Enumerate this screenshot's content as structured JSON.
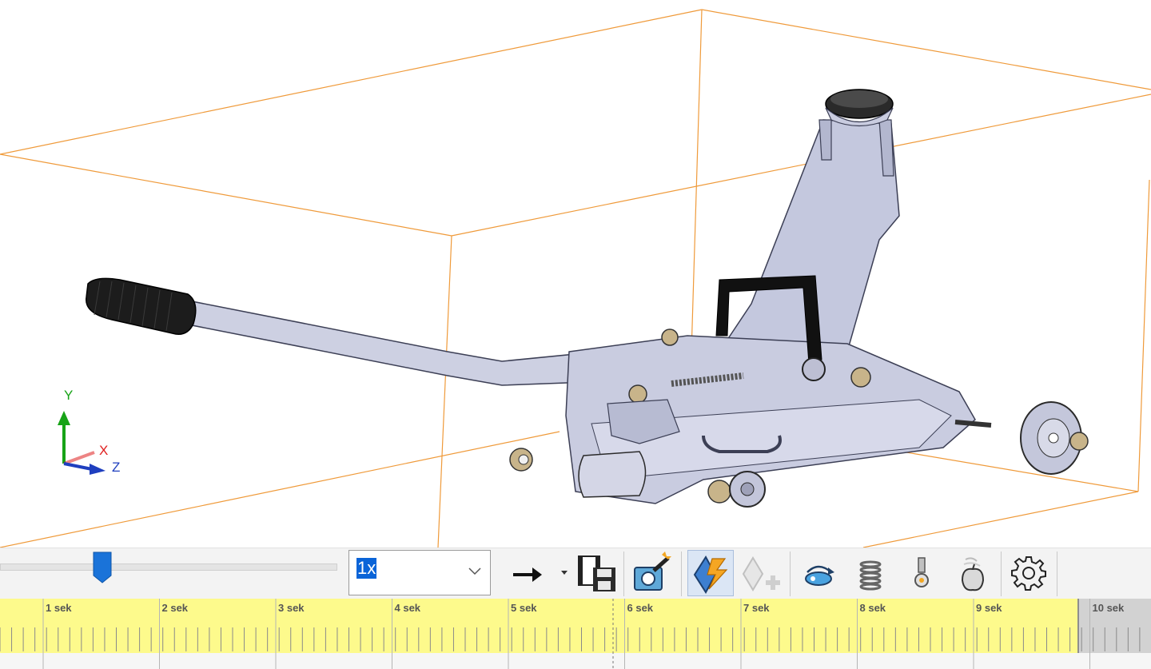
{
  "viewport": {
    "axis_triad": {
      "y_label": "Y",
      "x_label": "X",
      "z_label": "Z"
    },
    "colors": {
      "bounding_box": "#ef9a3a",
      "model": "#c7cbe0",
      "axis_x": "#e02020",
      "axis_y": "#17a317",
      "axis_z": "#1f3fbf"
    }
  },
  "toolbar": {
    "speed": {
      "value": "1x"
    },
    "icons": [
      "play-forward-icon",
      "save-animation-icon",
      "animation-wizard-icon",
      "calculate-icon",
      "add-key-icon",
      "motor-icon",
      "spring-icon",
      "contact-icon",
      "gravity-icon",
      "settings-icon"
    ]
  },
  "timeline": {
    "ticks": [
      "1 sek",
      "2 sek",
      "3 sek",
      "4 sek",
      "5 sek",
      "6 sek",
      "7 sek",
      "8 sek",
      "9 sek",
      "10 sek"
    ],
    "colors": {
      "active_band": "#fdfa8c",
      "inactive_band": "#d2d2d2"
    }
  }
}
